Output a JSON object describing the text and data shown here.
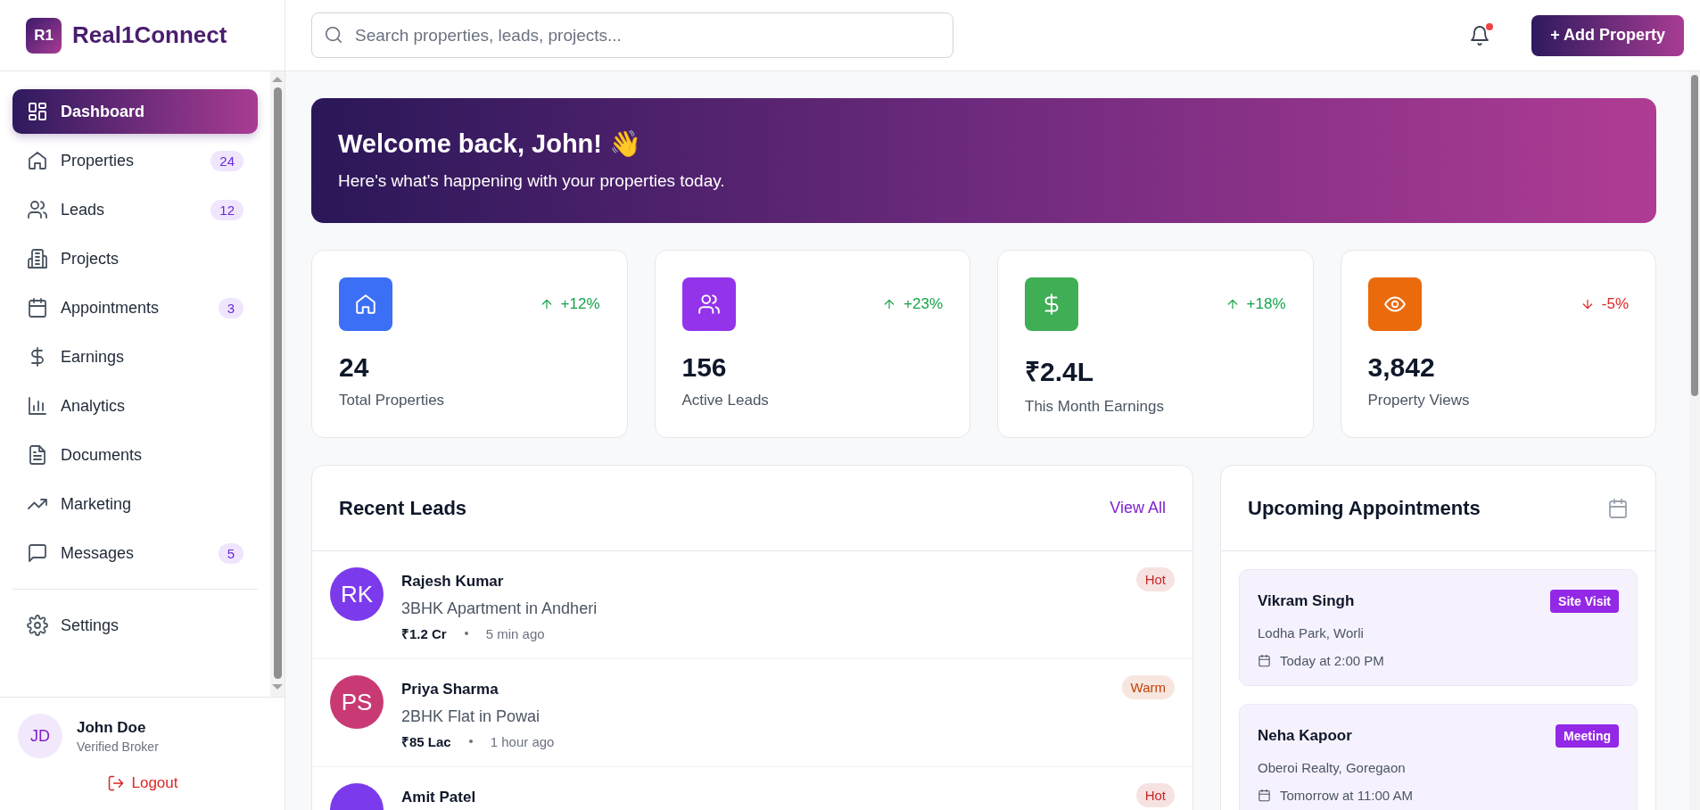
{
  "brand": {
    "mark": "R1",
    "name": "Real1Connect"
  },
  "search": {
    "placeholder": "Search properties, leads, projects..."
  },
  "notifications": {
    "unread": true
  },
  "add_button": "+ Add Property",
  "nav": [
    {
      "label": "Dashboard",
      "selected": true
    },
    {
      "label": "Properties",
      "selected": false,
      "badge": "24"
    },
    {
      "label": "Leads",
      "selected": false,
      "badge": "12"
    },
    {
      "label": "Projects",
      "selected": false
    },
    {
      "label": "Appointments",
      "selected": false,
      "badge": "3"
    },
    {
      "label": "Earnings",
      "selected": false
    },
    {
      "label": "Analytics",
      "selected": false
    },
    {
      "label": "Documents",
      "selected": false
    },
    {
      "label": "Marketing",
      "selected": false
    },
    {
      "label": "Messages",
      "selected": false,
      "badge": "5"
    }
  ],
  "nav_secondary": [
    {
      "label": "Settings",
      "selected": false
    }
  ],
  "user": {
    "initials": "JD",
    "name": "John Doe",
    "role": "Verified Broker"
  },
  "logout": "Logout",
  "banner": {
    "title": "Welcome back, John! 👋",
    "subtitle": "Here's what's happening with your properties today."
  },
  "stats": [
    {
      "value": "24",
      "label": "Total Properties",
      "change": "+12%",
      "falling": false,
      "color": "#3b6ff5"
    },
    {
      "value": "156",
      "label": "Active Leads",
      "change": "+23%",
      "falling": false,
      "color": "#9333ea"
    },
    {
      "value": "₹2.4L",
      "label": "This Month Earnings",
      "change": "+18%",
      "falling": false,
      "color": "#3fae55"
    },
    {
      "value": "3,842",
      "label": "Property Views",
      "change": "-5%",
      "falling": true,
      "color": "#ea6a0c"
    }
  ],
  "recent_leads": {
    "title": "Recent Leads",
    "link": "View All",
    "leads": [
      {
        "initials": "RK",
        "color": "#7c3aed",
        "name": "Rajesh Kumar",
        "interest": "3BHK Apartment in Andheri",
        "budget": "₹1.2 Cr",
        "time": "5 min ago",
        "status": {
          "label": "Hot",
          "color": "#c62828"
        }
      },
      {
        "initials": "PS",
        "color": "#c93a74",
        "name": "Priya Sharma",
        "interest": "2BHK Flat in Powai",
        "budget": "₹85 Lac",
        "time": "1 hour ago",
        "status": {
          "label": "Warm",
          "color": "#c2410c"
        }
      },
      {
        "color": "#7c3aed",
        "name": "Amit Patel",
        "status": {
          "label": "Hot",
          "color": "#c62828"
        }
      }
    ]
  },
  "appointments": {
    "title": "Upcoming Appointments",
    "items": [
      {
        "name": "Vikram Singh",
        "type": "Site Visit",
        "place": "Lodha Park, Worli",
        "when": "Today at 2:00 PM"
      },
      {
        "name": "Neha Kapoor",
        "type": "Meeting",
        "place": "Oberoi Realty, Goregaon",
        "when": "Tomorrow at 11:00 AM"
      }
    ]
  }
}
